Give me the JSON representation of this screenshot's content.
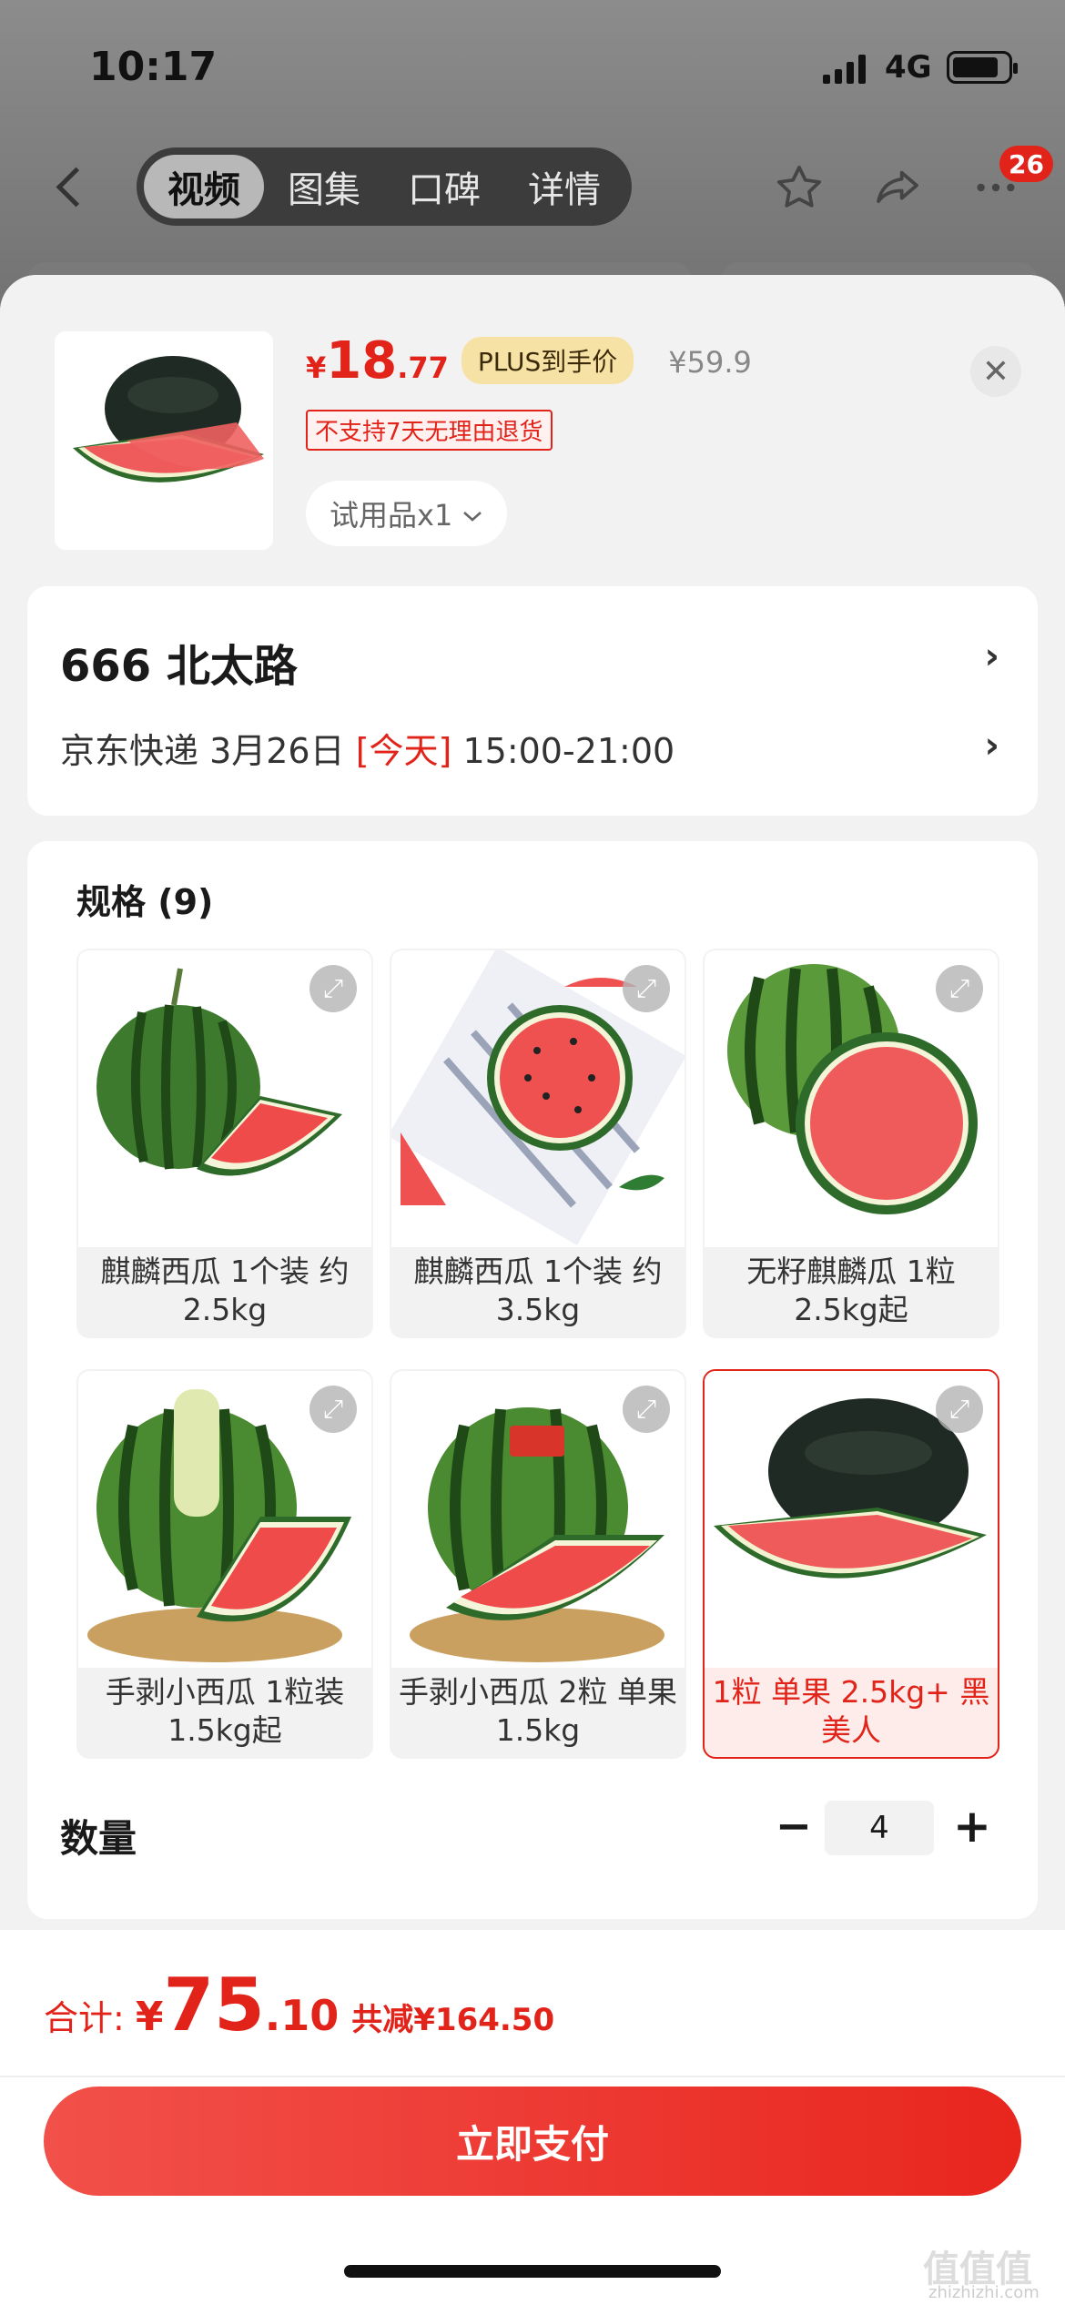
{
  "status_bar": {
    "time": "10:17",
    "network": "4G"
  },
  "nav": {
    "tabs": [
      {
        "label": "视频",
        "active": true
      },
      {
        "label": "图集",
        "active": false
      },
      {
        "label": "口碑",
        "active": false
      },
      {
        "label": "详情",
        "active": false
      }
    ],
    "cart_badge": "26",
    "icons": [
      "back-icon",
      "star-icon",
      "share-icon",
      "more-icon"
    ]
  },
  "product": {
    "price_symbol": "¥",
    "price_int": "18",
    "price_dec": ".77",
    "plus_tag": "PLUS到手价",
    "original_price": "¥59.9",
    "return_notice": "不支持7天无理由退货",
    "trial_chip": "试用品x1"
  },
  "address": {
    "line": "666  北太路",
    "carrier": "京东快递 3月26日",
    "today": "[今天]",
    "time_window": "15:00-21:00"
  },
  "spec": {
    "title": "规格 (9)",
    "items": [
      {
        "label": "麒麟西瓜 1个装 约2.5kg",
        "selected": false
      },
      {
        "label": "麒麟西瓜 1个装 约3.5kg",
        "selected": false
      },
      {
        "label": "无籽麒麟瓜 1粒 2.5kg起",
        "selected": false
      },
      {
        "label": "手剥小西瓜 1粒装 1.5kg起",
        "selected": false
      },
      {
        "label": "手剥小西瓜 2粒 单果1.5kg",
        "selected": false
      },
      {
        "label": "1粒 单果 2.5kg+ 黑美人",
        "selected": true
      }
    ]
  },
  "quantity": {
    "label": "数量",
    "value": "4"
  },
  "footer": {
    "total_label": "合计:",
    "total_symbol": "¥",
    "total_int": "75",
    "total_dec": ".10",
    "total_savings": "共减¥164.50",
    "pay_button": "立即支付",
    "watermark": "值值值",
    "watermark_sub": "zhizhizhi.com"
  },
  "colors": {
    "accent": "#e2231a",
    "plus_tag_bg": "#f7e2a6",
    "sheet_bg": "#f2f2f2"
  }
}
